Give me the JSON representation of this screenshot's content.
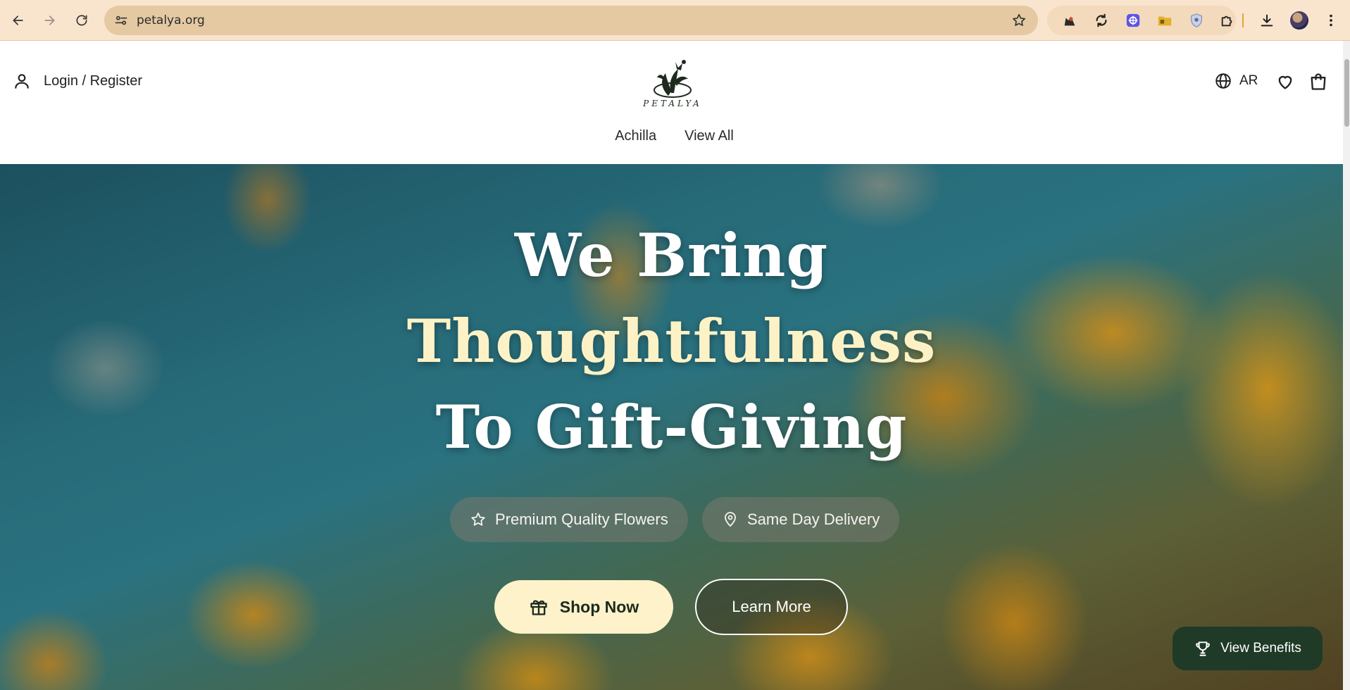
{
  "browser": {
    "url": "petalya.org"
  },
  "header": {
    "login_label": "Login / Register",
    "logo_text": "PETALYA",
    "language_label": "AR"
  },
  "nav": {
    "items": [
      {
        "label": "Achilla"
      },
      {
        "label": "View All"
      }
    ]
  },
  "hero": {
    "title_line1": "We Bring",
    "title_line2": "Thoughtfulness",
    "title_line3": "To Gift-Giving",
    "features": [
      {
        "label": "Premium Quality Flowers",
        "icon": "star-icon"
      },
      {
        "label": "Same Day Delivery",
        "icon": "map-pin-icon"
      }
    ],
    "shop_button": "Shop Now",
    "learn_button": "Learn More"
  },
  "floating": {
    "benefits_button": "View Benefits"
  },
  "colors": {
    "chrome_bg": "#f9e4cd",
    "accent_cream": "#fdf2c9",
    "accent_green": "#1f3a27"
  }
}
